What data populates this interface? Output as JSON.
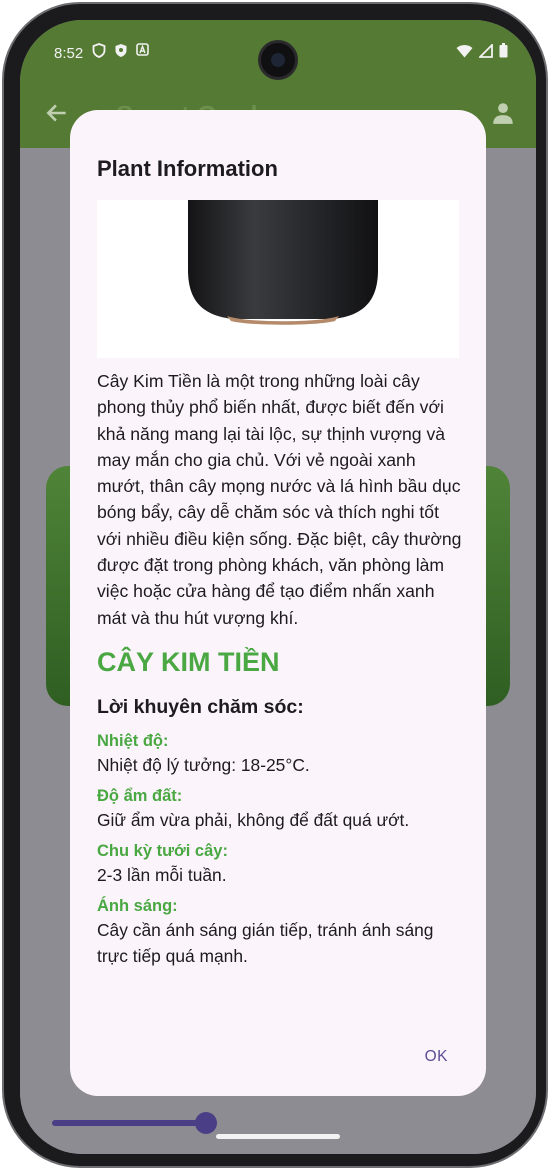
{
  "status_bar": {
    "time": "8:52",
    "left_icons": [
      "shield-outline-icon",
      "shield-filled-icon",
      "a-square-icon"
    ],
    "right_icons": [
      "wifi-icon",
      "signal-icon",
      "battery-icon"
    ]
  },
  "app_bar": {
    "title": "Smart Garden",
    "back_icon": "arrow-back-icon",
    "account_icon": "person-icon",
    "color": "#557a34"
  },
  "dialog": {
    "title": "Plant Information",
    "image_icon": "plant-pot-photo",
    "description": "Cây Kim Tiền là một trong những loài cây phong thủy phổ biến nhất, được biết đến với khả năng mang lại tài lộc, sự thịnh vượng và may mắn cho gia chủ. Với vẻ ngoài xanh mướt, thân cây mọng nước và lá hình bầu dục bóng bẩy, cây dễ chăm sóc và thích nghi tốt với nhiều điều kiện sống. Đặc biệt, cây thường được đặt trong phòng khách, văn phòng làm việc hoặc cửa hàng để tạo điểm nhấn xanh mát và thu hút vượng khí.",
    "plant_name": "CÂY KIM TIỀN",
    "care_heading": "Lời khuyên chăm sóc:",
    "care_items": [
      {
        "label": "Nhiệt độ:",
        "value": "Nhiệt độ lý tưởng: 18-25°C."
      },
      {
        "label": "Độ ẩm đất:",
        "value": "Giữ ẩm vừa phải, không để đất quá ướt."
      },
      {
        "label": "Chu kỳ tưới cây:",
        "value": "2-3 lần mỗi tuần."
      },
      {
        "label": "Ánh sáng:",
        "value": "Cây cần ánh sáng gián tiếp, tránh ánh sáng trực tiếp quá mạnh."
      }
    ],
    "ok_label": "OK",
    "accent_color": "#4aa843",
    "button_color": "#5b4c96"
  }
}
